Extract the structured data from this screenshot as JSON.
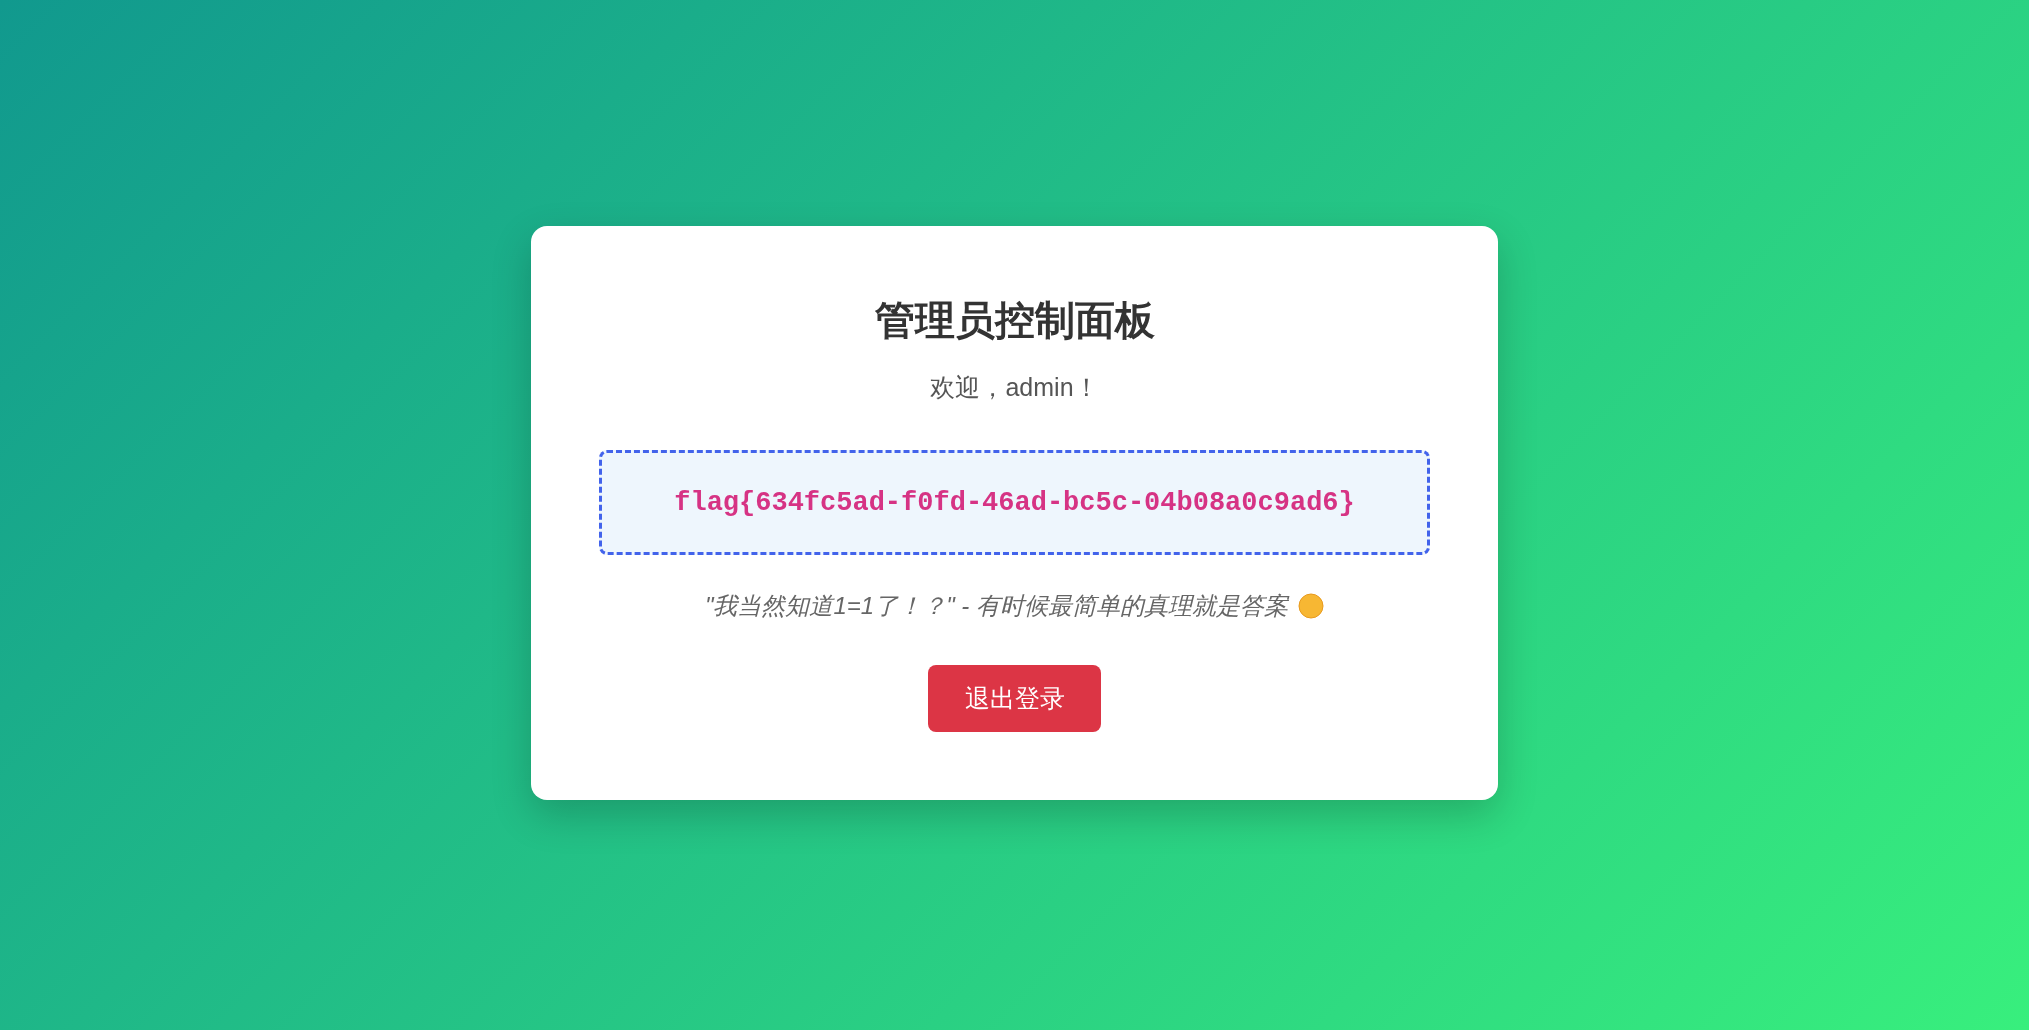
{
  "panel": {
    "title": "管理员控制面板",
    "welcome": "欢迎，admin！",
    "flag": "flag{634fc5ad-f0fd-46ad-bc5c-04b08a0c9ad6}",
    "quote": "\"我当然知道1=1了！？\" - 有时候最简单的真理就是答案",
    "logout_button": "退出登录"
  }
}
